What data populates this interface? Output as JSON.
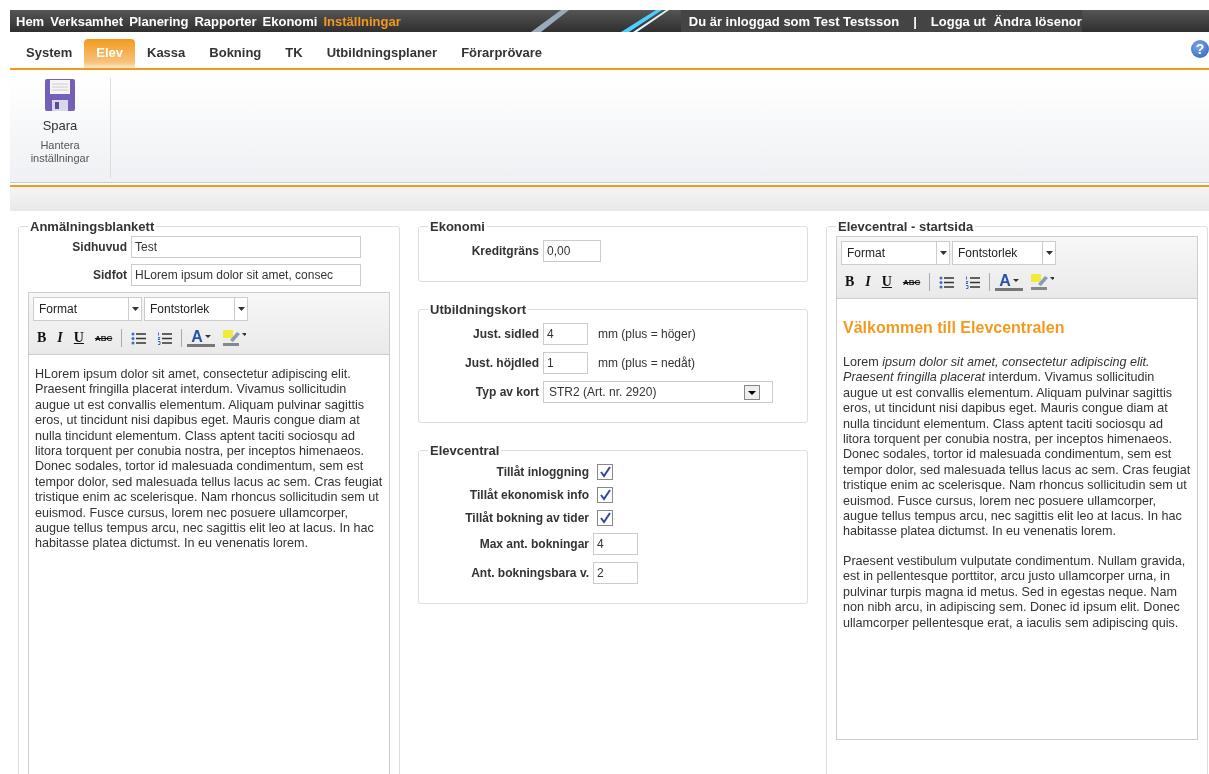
{
  "top_nav": {
    "items": [
      {
        "label": "Hem",
        "selected": false
      },
      {
        "label": "Verksamhet",
        "selected": false
      },
      {
        "label": "Planering",
        "selected": false
      },
      {
        "label": "Rapporter",
        "selected": false
      },
      {
        "label": "Ekonomi",
        "selected": false
      },
      {
        "label": "Inställningar",
        "selected": true
      }
    ],
    "user_text": "Du är inloggad som Test Testsson",
    "separator": "|",
    "links": [
      "Logga ut",
      "Ändra lösenor"
    ]
  },
  "tabs": [
    {
      "label": "System",
      "selected": false
    },
    {
      "label": "Elev",
      "selected": true
    },
    {
      "label": "Kassa",
      "selected": false
    },
    {
      "label": "Bokning",
      "selected": false
    },
    {
      "label": "TK",
      "selected": false
    },
    {
      "label": "Utbildningsplaner",
      "selected": false
    },
    {
      "label": "Förarprövare",
      "selected": false
    }
  ],
  "help_glyph": "?",
  "ribbon": {
    "buttons": [
      {
        "label": "Spara",
        "kind": "save"
      }
    ],
    "group_label": "Hantera inställningar"
  },
  "left_panel": {
    "title": "Anmälningsblankett",
    "fields": [
      {
        "label": "Sidhuvud",
        "value": "Test"
      },
      {
        "label": "Sidfot",
        "value": "HLorem ipsum dolor sit amet, consec"
      }
    ],
    "editor": {
      "format": "Format",
      "font_size": "Fontstorlek",
      "tools": [
        {
          "kind": "bold",
          "glyph": "B"
        },
        {
          "kind": "italic",
          "glyph": "I"
        },
        {
          "kind": "underline",
          "glyph": "U"
        },
        {
          "kind": "strike",
          "glyph": "ABC"
        },
        {
          "kind": "separator"
        },
        {
          "kind": "bullets"
        },
        {
          "kind": "numbers"
        },
        {
          "kind": "separator"
        },
        {
          "kind": "color",
          "glyph": "A"
        },
        {
          "kind": "highlight"
        }
      ],
      "paragraphs": [
        "HLorem ipsum dolor sit amet, consectetur adipiscing elit. Praesent fringilla placerat interdum. Vivamus sollicitudin augue ut est convallis elementum. Aliquam pulvinar sagittis eros, ut tincidunt nisi dapibus eget. Mauris congue diam at nulla tincidunt elementum. Class aptent taciti sociosqu ad litora torquent per conubia nostra, per inceptos himenaeos. Donec sodales, tortor id malesuada condimentum, sem est tempor dolor, sed malesuada tellus lacus ac sem. Cras feugiat tristique enim ac scelerisque. Nam rhoncus sollicitudin sem ut euismod. Fusce cursus, lorem nec posuere ullamcorper, augue tellus tempus arcu, nec sagittis elit leo at lacus. In hac habitasse platea dictumst. In eu venenatis lorem."
      ]
    }
  },
  "middle_panels": [
    {
      "title": "Ekonomi",
      "rows": [
        {
          "kind": "text",
          "label": "Kreditgräns",
          "value": "0,00"
        }
      ]
    },
    {
      "title": "Utbildningskort",
      "rows": [
        {
          "kind": "short",
          "label": "Just. sidled",
          "value": "4",
          "unit": "mm (plus = höger)"
        },
        {
          "kind": "short",
          "label": "Just. höjdled",
          "value": "1",
          "unit": "mm (plus = nedåt)"
        },
        {
          "kind": "select",
          "label": "Typ av kort",
          "value": "STR2 (Art. nr. 2920)"
        }
      ]
    },
    {
      "title": "Elevcentral",
      "rows": [
        {
          "kind": "checkbox",
          "label": "Tillåt inloggning",
          "checked": true
        },
        {
          "kind": "checkbox",
          "label": "Tillåt ekonomisk info",
          "checked": true
        },
        {
          "kind": "checkbox",
          "label": "Tillåt bokning av tider",
          "checked": true
        },
        {
          "kind": "short",
          "label": "Max ant. bokningar",
          "value": "4"
        },
        {
          "kind": "short",
          "label": "Ant. bokningsbara v.",
          "value": "2"
        }
      ]
    }
  ],
  "right_panel": {
    "title": "Elevcentral - startsida",
    "editor": {
      "format": "Format",
      "font_size": "Fontstorlek",
      "tools": [
        {
          "kind": "bold",
          "glyph": "B"
        },
        {
          "kind": "italic",
          "glyph": "I"
        },
        {
          "kind": "underline",
          "glyph": "U"
        },
        {
          "kind": "strike",
          "glyph": "ABC"
        },
        {
          "kind": "separator"
        },
        {
          "kind": "bullets"
        },
        {
          "kind": "numbers"
        },
        {
          "kind": "separator"
        },
        {
          "kind": "color",
          "glyph": "A"
        },
        {
          "kind": "highlight"
        }
      ],
      "heading": "Välkommen till Elevcentralen",
      "paragraphs": [
        "Lorem *ipsum dolor sit amet, consectetur adipiscing elit. Praesent fringilla placerat* interdum. Vivamus sollicitudin augue ut est convallis elementum. Aliquam pulvinar sagittis eros, ut tincidunt nisi dapibus eget. Mauris congue diam at nulla tincidunt elementum. Class aptent taciti sociosqu ad litora torquent per conubia nostra, per inceptos himenaeos. Donec sodales, tortor id malesuada condimentum, sem est tempor dolor, sed malesuada tellus lacus ac sem. Cras feugiat tristique enim ac scelerisque. Nam rhoncus sollicitudin sem ut euismod. Fusce cursus, lorem nec posuere ullamcorper, augue tellus tempus arcu, nec sagittis elit leo at lacus. In hac habitasse platea dictumst. In eu venenatis lorem.",
        "Praesent vestibulum vulputate condimentum. Nullam gravida, est in pellentesque porttitor, arcu justo ullamcorper urna, in pulvinar turpis magna id metus. Sed in egestas neque. Nam non nibh arcu, in adipiscing sem. Donec id ipsum elit. Donec ullamcorper pellentesque erat, a iaculis sem adipiscing quis."
      ]
    }
  }
}
